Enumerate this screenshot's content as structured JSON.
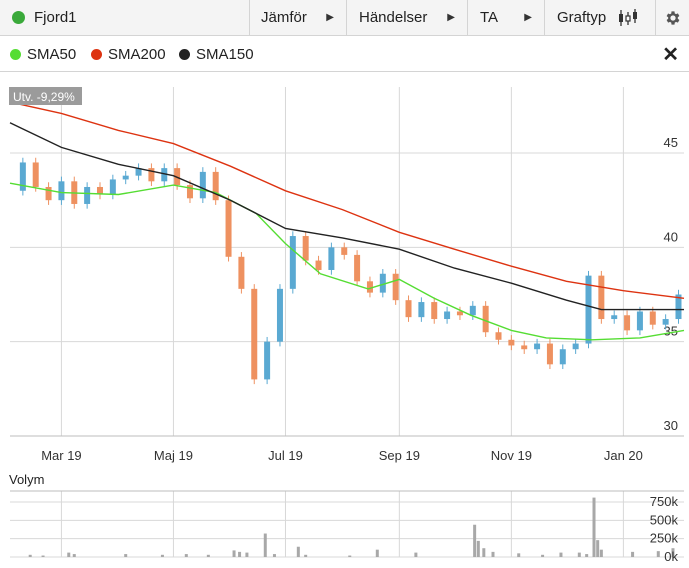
{
  "toolbar": {
    "ticker": "Fjord1",
    "ticker_dot_color": "#3aa93a",
    "compare_label": "Jämför",
    "events_label": "Händelser",
    "ta_label": "TA",
    "charttype_label": "Graftyp",
    "charttype_icon": "candlestick-icon",
    "settings_icon": "gear-icon"
  },
  "legend": {
    "items": [
      {
        "label": "SMA50",
        "color": "#55dd33"
      },
      {
        "label": "SMA200",
        "color": "#dd3311"
      },
      {
        "label": "SMA150",
        "color": "#222222"
      }
    ],
    "close_icon": "close-icon"
  },
  "badge": "Utv. -9,29%",
  "volume_title": "Volym",
  "colors": {
    "up": "#5aa9d2",
    "down": "#ee9160",
    "grid": "#d8d8d8"
  },
  "chart_data": [
    {
      "type": "candlestick",
      "title": "",
      "x_tick_labels": [
        "Mar 19",
        "Maj 19",
        "Jul 19",
        "Sep 19",
        "Nov 19",
        "Jan 20"
      ],
      "x_tick_dates": [
        "2019-03-01",
        "2019-05-01",
        "2019-07-01",
        "2019-09-01",
        "2019-11-01",
        "2020-01-01"
      ],
      "x_range": [
        "2019-02-01",
        "2020-02-03"
      ],
      "ylim": [
        30,
        48.5
      ],
      "y_ticks": [
        30,
        35,
        40,
        45
      ],
      "y_tick_labels": [
        "30",
        "35",
        "40",
        "45"
      ],
      "grid": true,
      "closes": [
        [
          "2019-02-01",
          43
        ],
        [
          "2019-02-08",
          44.5
        ],
        [
          "2019-02-15",
          43.2
        ],
        [
          "2019-02-22",
          42.5
        ],
        [
          "2019-03-01",
          43.5
        ],
        [
          "2019-03-08",
          42.3
        ],
        [
          "2019-03-15",
          43.2
        ],
        [
          "2019-03-22",
          42.8
        ],
        [
          "2019-03-29",
          43.6
        ],
        [
          "2019-04-05",
          43.8
        ],
        [
          "2019-04-12",
          44.2
        ],
        [
          "2019-04-19",
          43.5
        ],
        [
          "2019-04-26",
          44.2
        ],
        [
          "2019-05-03",
          43.3
        ],
        [
          "2019-05-10",
          42.6
        ],
        [
          "2019-05-17",
          44
        ],
        [
          "2019-05-24",
          42.5
        ],
        [
          "2019-05-31",
          39.5
        ],
        [
          "2019-06-07",
          37.8
        ],
        [
          "2019-06-14",
          33
        ],
        [
          "2019-06-21",
          35
        ],
        [
          "2019-06-28",
          37.8
        ],
        [
          "2019-07-05",
          40.6
        ],
        [
          "2019-07-12",
          39.3
        ],
        [
          "2019-07-19",
          38.8
        ],
        [
          "2019-07-26",
          40
        ],
        [
          "2019-08-02",
          39.6
        ],
        [
          "2019-08-09",
          38.2
        ],
        [
          "2019-08-16",
          37.6
        ],
        [
          "2019-08-23",
          38.6
        ],
        [
          "2019-08-30",
          37.2
        ],
        [
          "2019-09-06",
          36.3
        ],
        [
          "2019-09-13",
          37.1
        ],
        [
          "2019-09-20",
          36.2
        ],
        [
          "2019-09-27",
          36.6
        ],
        [
          "2019-10-04",
          36.4
        ],
        [
          "2019-10-11",
          36.9
        ],
        [
          "2019-10-18",
          35.5
        ],
        [
          "2019-10-25",
          35.1
        ],
        [
          "2019-11-01",
          34.8
        ],
        [
          "2019-11-08",
          34.6
        ],
        [
          "2019-11-15",
          34.9
        ],
        [
          "2019-11-22",
          33.8
        ],
        [
          "2019-11-29",
          34.6
        ],
        [
          "2019-12-06",
          34.9
        ],
        [
          "2019-12-13",
          38.5
        ],
        [
          "2019-12-20",
          36.2
        ],
        [
          "2019-12-27",
          36.4
        ],
        [
          "2020-01-03",
          35.6
        ],
        [
          "2020-01-10",
          36.6
        ],
        [
          "2020-01-17",
          35.9
        ],
        [
          "2020-01-24",
          36.2
        ],
        [
          "2020-01-31",
          37.5
        ]
      ],
      "series": [
        {
          "name": "SMA50",
          "color": "#55dd33",
          "points": [
            [
              "2019-02-01",
              43.4
            ],
            [
              "2019-03-01",
              42.9
            ],
            [
              "2019-04-01",
              42.8
            ],
            [
              "2019-05-01",
              43.3
            ],
            [
              "2019-05-24",
              42.9
            ],
            [
              "2019-06-15",
              41.8
            ],
            [
              "2019-07-01",
              40.2
            ],
            [
              "2019-07-20",
              38.6
            ],
            [
              "2019-08-15",
              37.8
            ],
            [
              "2019-09-01",
              38.3
            ],
            [
              "2019-09-20",
              37.3
            ],
            [
              "2019-10-10",
              36.4
            ],
            [
              "2019-11-01",
              35.6
            ],
            [
              "2019-11-20",
              35.2
            ],
            [
              "2019-12-15",
              35.1
            ],
            [
              "2020-01-10",
              35.2
            ],
            [
              "2020-02-03",
              35.6
            ]
          ]
        },
        {
          "name": "SMA150",
          "color": "#222222",
          "points": [
            [
              "2019-02-01",
              46.6
            ],
            [
              "2019-03-01",
              45.3
            ],
            [
              "2019-04-01",
              44.4
            ],
            [
              "2019-05-01",
              43.8
            ],
            [
              "2019-06-01",
              42.5
            ],
            [
              "2019-07-01",
              41
            ],
            [
              "2019-08-01",
              40.5
            ],
            [
              "2019-09-01",
              39.9
            ],
            [
              "2019-10-01",
              38.9
            ],
            [
              "2019-11-01",
              38.1
            ],
            [
              "2019-12-01",
              37.2
            ],
            [
              "2019-12-20",
              36.7
            ],
            [
              "2020-01-15",
              36.7
            ],
            [
              "2020-02-03",
              36.7
            ]
          ]
        },
        {
          "name": "SMA200",
          "color": "#dd3311",
          "points": [
            [
              "2019-02-01",
              47.7
            ],
            [
              "2019-03-01",
              47.1
            ],
            [
              "2019-04-01",
              46.2
            ],
            [
              "2019-05-01",
              45.5
            ],
            [
              "2019-06-01",
              44.3
            ],
            [
              "2019-07-01",
              43
            ],
            [
              "2019-08-01",
              42
            ],
            [
              "2019-09-01",
              40.8
            ],
            [
              "2019-10-01",
              39.9
            ],
            [
              "2019-11-01",
              39
            ],
            [
              "2019-12-01",
              38.2
            ],
            [
              "2020-01-01",
              37.7
            ],
            [
              "2020-02-03",
              37.3
            ]
          ]
        }
      ]
    },
    {
      "type": "bar",
      "title": "Volym",
      "ylim": [
        0,
        900000
      ],
      "y_ticks": [
        0,
        250000,
        500000,
        750000
      ],
      "y_tick_labels": [
        "0k",
        "250k",
        "500k",
        "750k"
      ],
      "values": [
        [
          "2019-02-12",
          30000
        ],
        [
          "2019-02-19",
          20000
        ],
        [
          "2019-03-05",
          60000
        ],
        [
          "2019-03-08",
          40000
        ],
        [
          "2019-04-05",
          40000
        ],
        [
          "2019-04-25",
          30000
        ],
        [
          "2019-05-08",
          40000
        ],
        [
          "2019-05-20",
          30000
        ],
        [
          "2019-06-03",
          90000
        ],
        [
          "2019-06-06",
          70000
        ],
        [
          "2019-06-10",
          60000
        ],
        [
          "2019-06-20",
          320000
        ],
        [
          "2019-06-25",
          40000
        ],
        [
          "2019-07-08",
          140000
        ],
        [
          "2019-07-12",
          30000
        ],
        [
          "2019-08-05",
          20000
        ],
        [
          "2019-08-20",
          100000
        ],
        [
          "2019-09-10",
          60000
        ],
        [
          "2019-10-12",
          440000
        ],
        [
          "2019-10-14",
          220000
        ],
        [
          "2019-10-17",
          120000
        ],
        [
          "2019-10-22",
          70000
        ],
        [
          "2019-11-05",
          50000
        ],
        [
          "2019-11-18",
          30000
        ],
        [
          "2019-11-28",
          60000
        ],
        [
          "2019-12-08",
          60000
        ],
        [
          "2019-12-12",
          40000
        ],
        [
          "2019-12-16",
          810000
        ],
        [
          "2019-12-18",
          230000
        ],
        [
          "2019-12-20",
          100000
        ],
        [
          "2020-01-06",
          70000
        ],
        [
          "2020-01-20",
          80000
        ],
        [
          "2020-01-28",
          120000
        ]
      ]
    }
  ]
}
